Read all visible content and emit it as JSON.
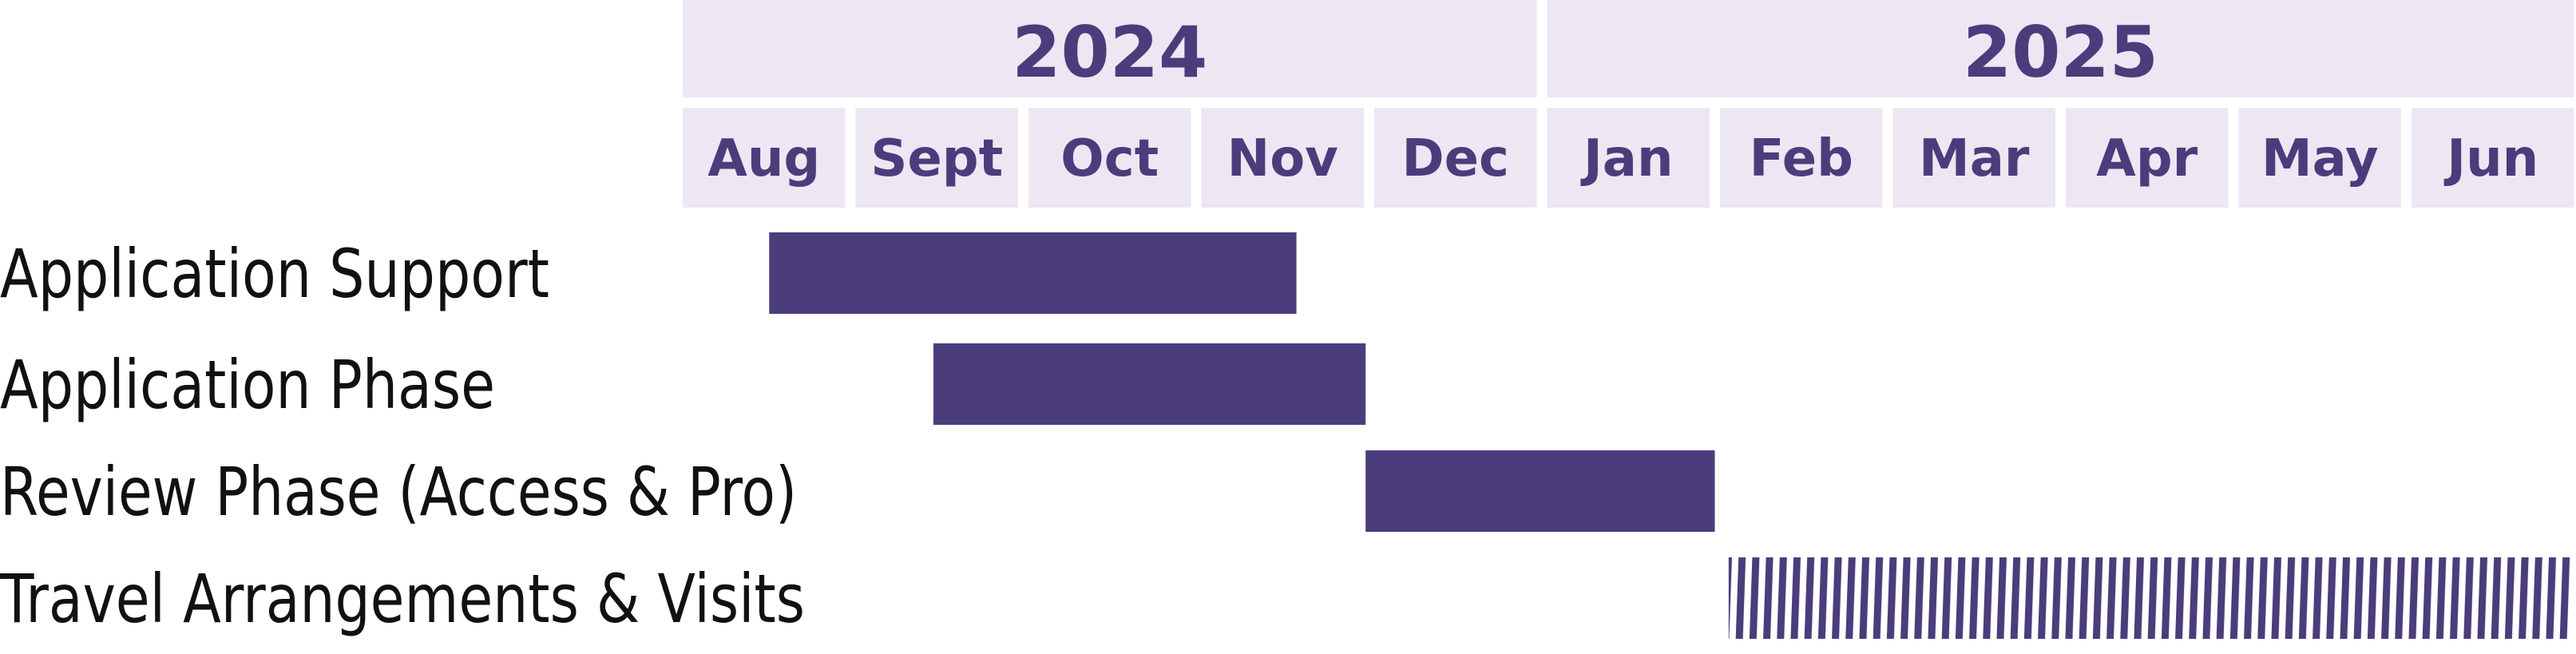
{
  "chart_data": {
    "type": "gantt",
    "title": "",
    "colors": {
      "header_bg": "#EDE7F4",
      "accent": "#4B3D7C",
      "label": "#111111"
    },
    "years": [
      {
        "label": "2024",
        "months": [
          "Aug",
          "Sept",
          "Oct",
          "Nov",
          "Dec"
        ]
      },
      {
        "label": "2025",
        "months": [
          "Jan",
          "Feb",
          "Mar",
          "Apr",
          "May",
          "Jun"
        ]
      }
    ],
    "months": [
      "Aug",
      "Sept",
      "Oct",
      "Nov",
      "Dec",
      "Jan",
      "Feb",
      "Mar",
      "Apr",
      "May",
      "Jun"
    ],
    "tasks": [
      {
        "label": "Application Support",
        "start": 0.5,
        "end": 3.55,
        "style": "solid"
      },
      {
        "label": "Application Phase",
        "start": 1.45,
        "end": 3.95,
        "style": "solid"
      },
      {
        "label": "Review Phase (Access & Pro)",
        "start": 3.95,
        "end": 5.97,
        "style": "solid"
      },
      {
        "label": "Travel Arrangements & Visits",
        "start": 6.05,
        "end": 11.0,
        "style": "striped"
      }
    ],
    "xunit": "months from start of Aug 2024"
  }
}
